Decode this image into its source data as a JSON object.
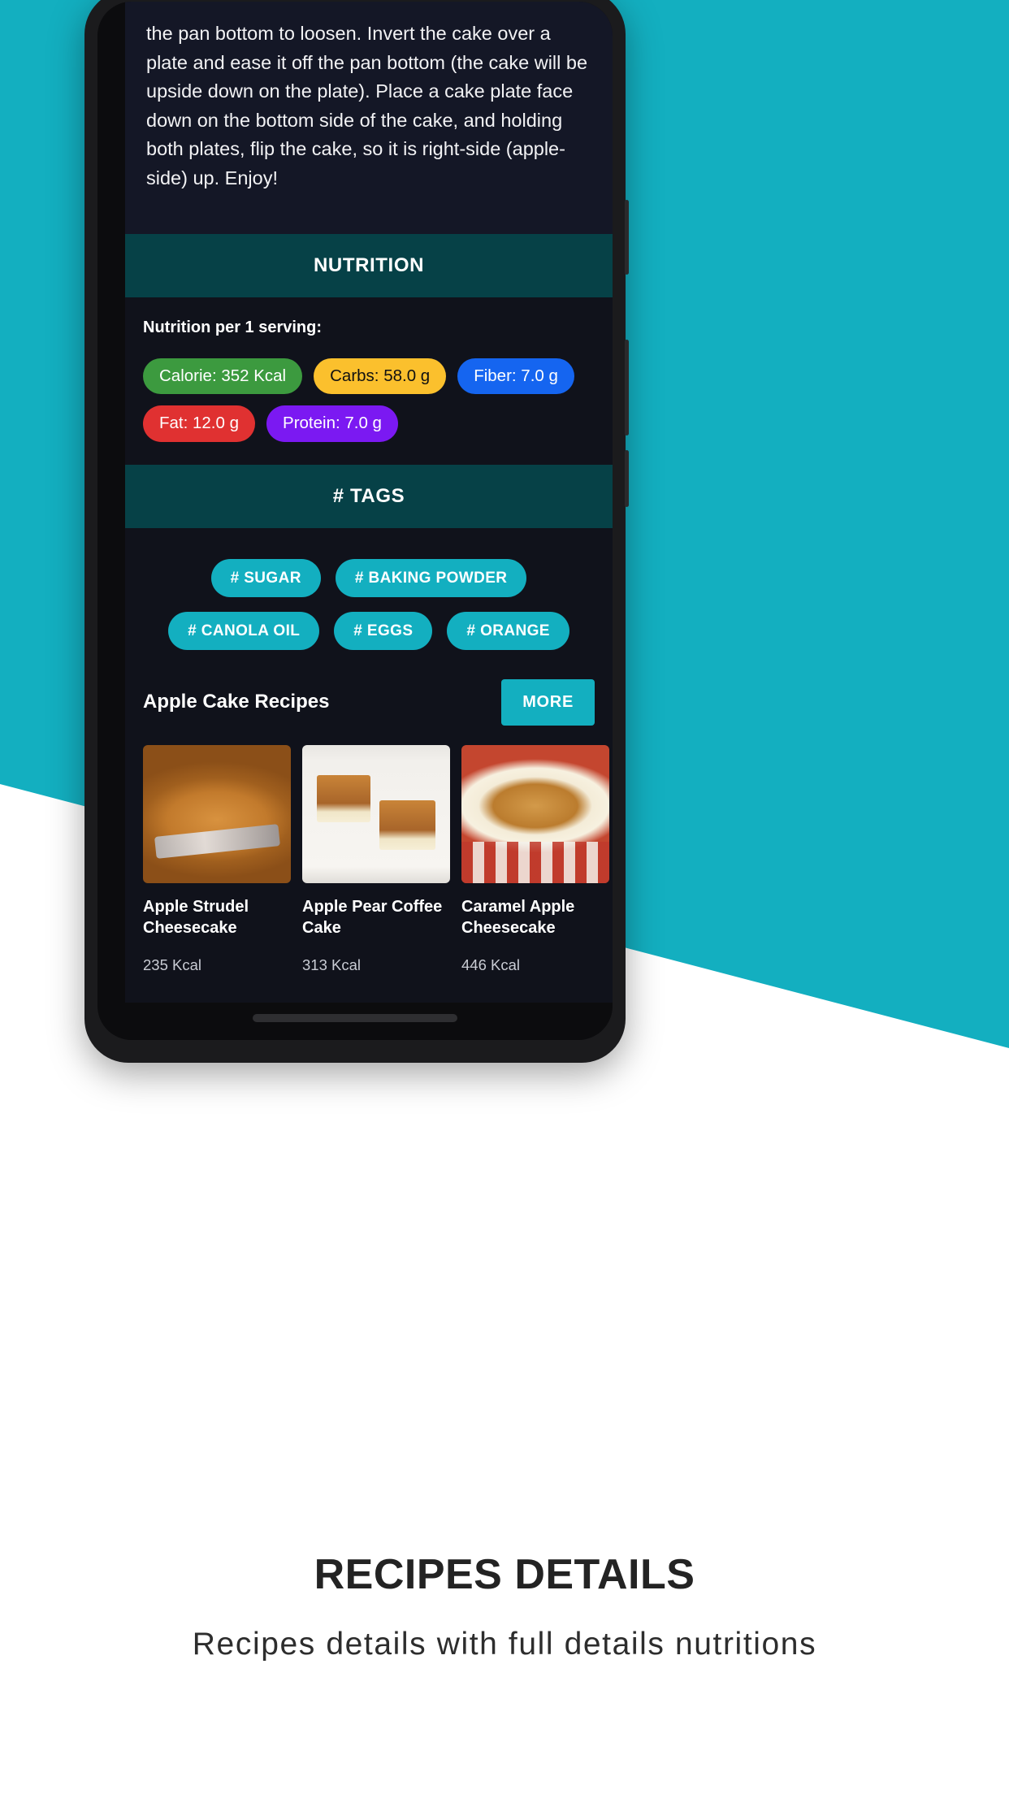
{
  "background": {
    "accent_color": "#13AFC0",
    "page_background": "#FFFFFF"
  },
  "phone": {
    "screen_background": "#10121B"
  },
  "screen": {
    "instructions": {
      "text": "the pan bottom to loosen. Invert the cake over a plate and ease it off the pan bottom (the cake will be upside down on the plate). Place a cake plate face down on the bottom side of the cake, and holding both plates, flip the cake, so it is right-side (apple-side) up. Enjoy!"
    },
    "nutrition_section": {
      "header": "NUTRITION",
      "header_bg": "#064147",
      "serving_label": "Nutrition per 1 serving:",
      "items": [
        {
          "label": "Calorie: 352 Kcal",
          "bg": "#3C9A3F",
          "fg": "#FFFFFF"
        },
        {
          "label": "Carbs: 58.0 g",
          "bg": "#FBC02D",
          "fg": "#111111"
        },
        {
          "label": "Fiber: 7.0 g",
          "bg": "#1565F0",
          "fg": "#FFFFFF"
        },
        {
          "label": "Fat: 12.0 g",
          "bg": "#E03131",
          "fg": "#FFFFFF"
        },
        {
          "label": "Protein: 7.0 g",
          "bg": "#7B19F2",
          "fg": "#FFFFFF"
        }
      ]
    },
    "tags_section": {
      "header": "# TAGS",
      "header_bg": "#064147",
      "tags": [
        "# SUGAR",
        "# BAKING POWDER",
        "# CANOLA OIL",
        "# EGGS",
        "# ORANGE"
      ]
    },
    "related_section": {
      "title": "Apple Cake Recipes",
      "more_label": "MORE",
      "cards": [
        {
          "name": "Apple Strudel Cheesecake",
          "kcal": "235 Kcal",
          "image": "apple-strudel-cheesecake-photo"
        },
        {
          "name": "Apple Pear Coffee Cake",
          "kcal": "313 Kcal",
          "image": "apple-pear-coffee-cake-photo"
        },
        {
          "name": "Caramel Apple Cheesecake",
          "kcal": "446 Kcal",
          "image": "caramel-apple-cheesecake-photo"
        }
      ]
    }
  },
  "promo": {
    "title": "RECIPES DETAILS",
    "subtitle": "Recipes details with full details nutritions"
  }
}
